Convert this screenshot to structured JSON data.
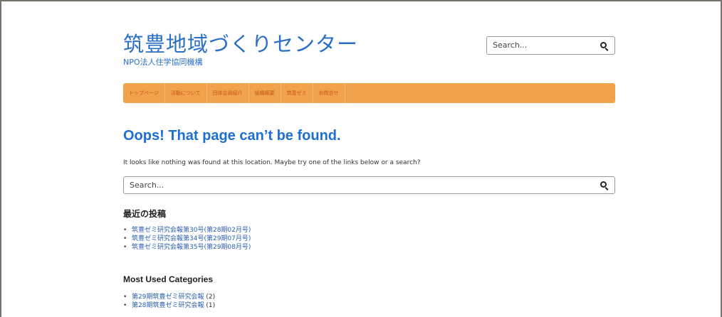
{
  "site": {
    "title": "筑豊地域づくりセンター",
    "description": "NPO法人住学協同機構"
  },
  "header_search": {
    "placeholder": "Search..."
  },
  "nav": {
    "items": [
      "トップページ",
      "活動について",
      "団体会員紹介",
      "組織概要",
      "筑豊ゼミ",
      "お問合せ"
    ]
  },
  "main": {
    "heading": "Oops! That page can’t be found.",
    "intro": "It looks like nothing was found at this location. Maybe try one of the links below or a search?",
    "search": {
      "placeholder": "Search..."
    },
    "recent_posts": {
      "title": "最近の投稿",
      "items": [
        "筑豊ゼミ研究会報第30号(第28期02月号)",
        "筑豊ゼミ研究会報第34号(第29期07月号)",
        "筑豊ゼミ研究会報第35号(第29期08月号)"
      ]
    },
    "categories": {
      "title": "Most Used Categories",
      "items": [
        {
          "name": "第29期筑豊ゼミ研究会報",
          "count": "(2)"
        },
        {
          "name": "第28期筑豊ゼミ研究会報",
          "count": "(1)"
        }
      ]
    }
  },
  "colors": {
    "link_blue": "#2a6fc6",
    "heading_blue": "#1d6fd1",
    "nav_bg": "#f0a34b",
    "nav_text": "#c75318",
    "frame_border": "#77736b"
  },
  "icons": {
    "search": "search-icon"
  }
}
